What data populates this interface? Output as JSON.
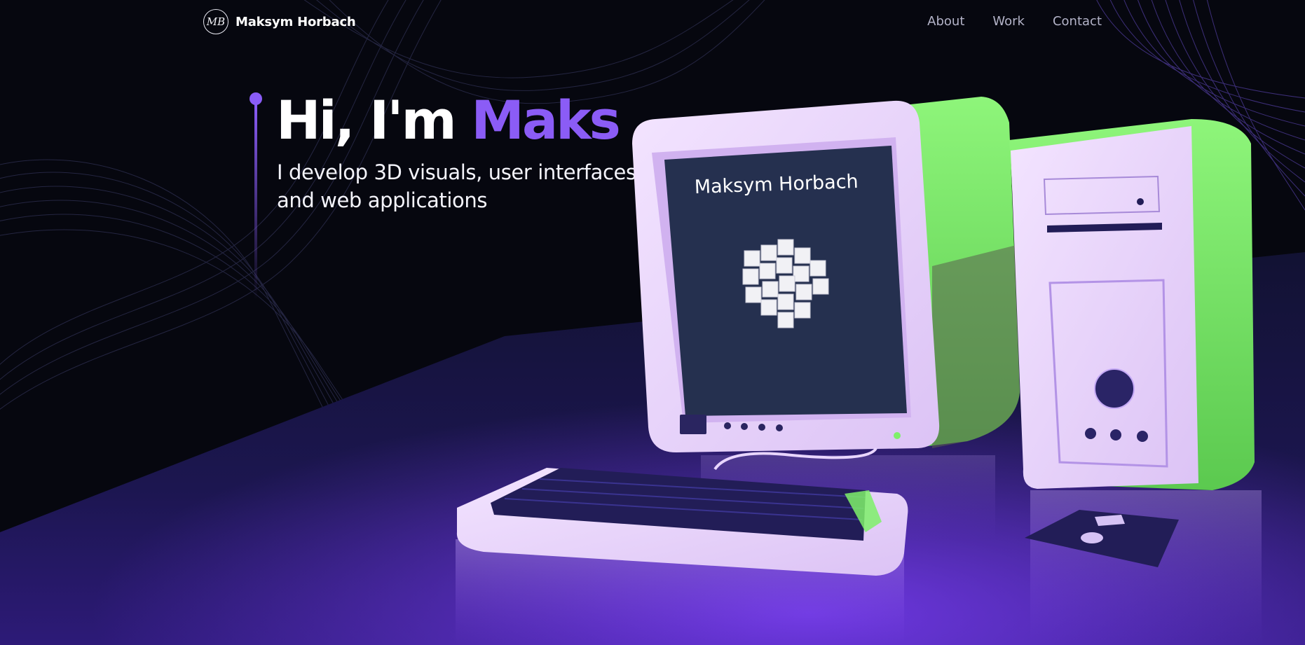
{
  "nav": {
    "logo_monogram": "MB",
    "brand_name": "Maksym Horbach",
    "links": [
      "About",
      "Work",
      "Contact"
    ]
  },
  "hero": {
    "greeting": "Hi, I'm ",
    "name": "Maks",
    "subtitle": "I develop 3D visuals, user interfaces and web applications"
  },
  "scene": {
    "screen_text": "Maksym Horbach"
  },
  "colors": {
    "background": "#06070f",
    "accent": "#8b5cf6",
    "computer_body": "#ecd8fb",
    "green_light": "#7ef06a",
    "screen": "#25304f"
  }
}
